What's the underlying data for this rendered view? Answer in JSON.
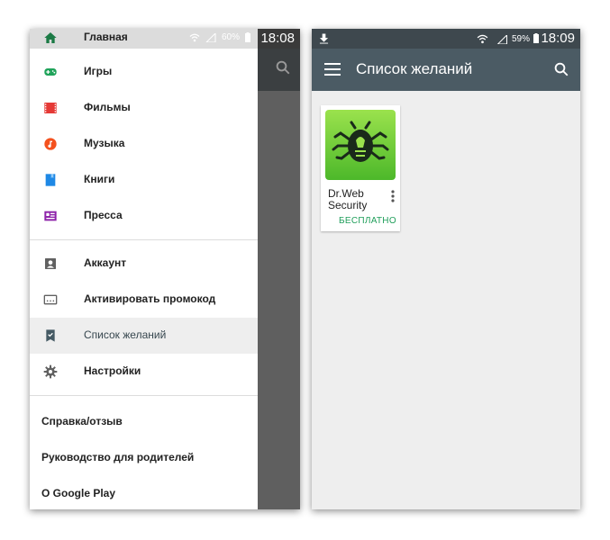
{
  "left_phone": {
    "status": {
      "battery": "60%",
      "time": "18:08"
    },
    "drawer": {
      "primary": [
        {
          "label": "Главная",
          "icon": "home-icon",
          "color": "#1b7a45"
        },
        {
          "label": "Игры",
          "icon": "gamepad-icon",
          "color": "#1fa35a"
        },
        {
          "label": "Фильмы",
          "icon": "film-icon",
          "color": "#e53935"
        },
        {
          "label": "Музыка",
          "icon": "music-icon",
          "color": "#f4511e"
        },
        {
          "label": "Книги",
          "icon": "book-icon",
          "color": "#1e88e5"
        },
        {
          "label": "Пресса",
          "icon": "newsstand-icon",
          "color": "#8e24aa"
        }
      ],
      "secondary": [
        {
          "label": "Аккаунт",
          "icon": "account-icon"
        },
        {
          "label": "Активировать промокод",
          "icon": "redeem-icon"
        },
        {
          "label": "Список желаний",
          "icon": "wishlist-icon",
          "selected": true
        },
        {
          "label": "Настройки",
          "icon": "settings-icon"
        }
      ],
      "footer": [
        "Справка/отзыв",
        "Руководство для родителей",
        "О Google Play"
      ]
    }
  },
  "right_phone": {
    "status": {
      "battery": "59%",
      "time": "18:09"
    },
    "appbar": {
      "title": "Список желаний"
    },
    "items": [
      {
        "name": "Dr.Web Security",
        "price": "БЕСПЛАТНО"
      }
    ]
  }
}
